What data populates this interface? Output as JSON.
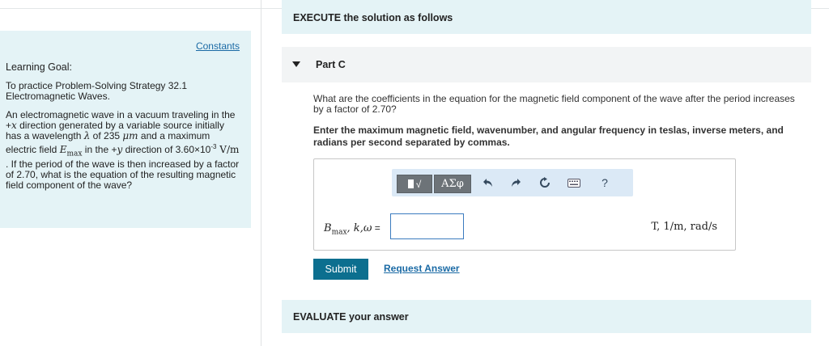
{
  "left_panel": {
    "constants_link": "Constants",
    "title": "Learning Goal:",
    "goal_text": "To practice Problem-Solving Strategy 32.1 Electromagnetic Waves.",
    "problem": {
      "p1": "An electromagnetic wave in a vacuum traveling in the +",
      "x_var": "x",
      "p2": " direction generated by a variable source initially has a wavelength ",
      "lambda": "λ",
      "p3": " of 235 ",
      "unit_um": "μm",
      "p4": " and a maximum electric field ",
      "emax": "E",
      "emax_sub": "max",
      "p5": " in the +",
      "y_var": "y",
      "p6": " direction of 3.60×10",
      "exp": "-3",
      "unit_vm": " V/m",
      "p7": " . If the period of the wave is then increased by a factor of 2.70, what is the equation of the resulting magnetic field component of the wave?"
    }
  },
  "execute_header": "EXECUTE the solution as follows",
  "part": {
    "label": "Part C",
    "question": "What are the coefficients in the equation for the magnetic field component of the wave after the period increases by a factor of 2.70?",
    "instructions": "Enter the maximum magnetic field, wavenumber, and angular frequency in teslas, inverse meters, and radians per second separated by commas."
  },
  "toolbar": {
    "templates_label": "√",
    "symbols_label": "ΑΣφ",
    "undo_icon": "undo-icon",
    "redo_icon": "redo-icon",
    "reset_icon": "reset-icon",
    "keyboard_icon": "keyboard-icon",
    "help_label": "?"
  },
  "answer": {
    "label_b": "B",
    "label_sub": "max",
    "label_rest": ", k,ω",
    "label_eq": " =",
    "value": "",
    "units": "T, 1/m, rad/s"
  },
  "submit_label": "Submit",
  "request_label": "Request Answer",
  "evaluate_header": "EVALUATE your answer"
}
